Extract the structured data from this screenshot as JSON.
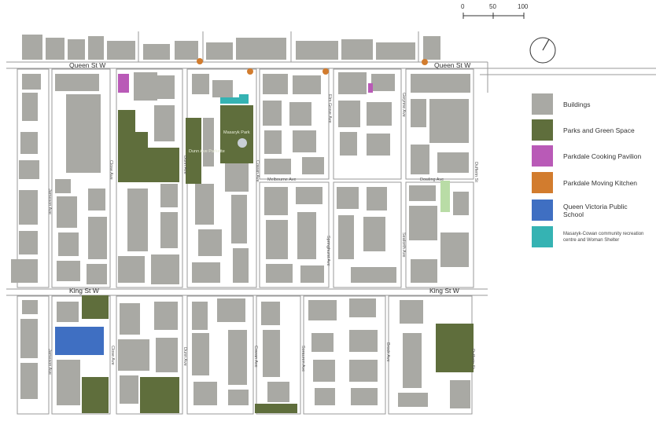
{
  "map": {
    "scale_bar": {
      "ticks": [
        "0",
        "50",
        "100"
      ]
    },
    "streets": {
      "queen_st_w": "Queen St W",
      "king_st_w": "King St W",
      "jameson_ave": "Jameson Ave",
      "close_ave": "Close Ave",
      "dunn_ave": "Dunn Ave",
      "cowan_ave": "Cowan Ave",
      "elm_grove_ave": "Elm Grove Ave",
      "gwynne_ave": "Gwynne Ave",
      "dufferin_st": "Dufferin St",
      "dunn_ave_lower": "Dunn Ave",
      "dowling_ave": "Dowling Ave",
      "springhurst_ave": "Springhurst Ave",
      "melbourne_ave": "Melbourne Ave",
      "seaforth_ave": "Seaforth Ave",
      "sorauren_ave": "Sorauren Ave",
      "brock_ave": "Brock Ave"
    },
    "parks": {
      "masaryk_park": "Masaryk Park",
      "dunn_ave_parkette": "Dunn Ave Parkette"
    }
  },
  "legend": {
    "items": [
      {
        "label": "Buildings",
        "color": "#a9a9a4"
      },
      {
        "label": "Parks and Green Space",
        "color": "#5f6e3c"
      },
      {
        "label": "Parkdale Cooking Pavilion",
        "color": "#b95ab7"
      },
      {
        "label": "Parkdale Moving Kitchen",
        "color": "#d27c2e"
      },
      {
        "label": "Queen Victoria Public School",
        "color": "#3f6fc2"
      },
      {
        "label": "Masaryk-Cowan community recreation centre and Woman Shelter",
        "color": "#35b3b3"
      }
    ]
  }
}
